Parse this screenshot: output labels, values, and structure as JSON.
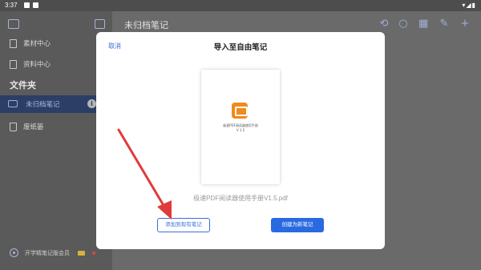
{
  "statusbar": {
    "time": "3:37"
  },
  "sidebar": {
    "items": [
      {
        "label": "素材中心"
      },
      {
        "label": "资料中心"
      }
    ],
    "folder_title": "文件夹",
    "folders": [
      {
        "label": "未归档笔记",
        "active": true
      },
      {
        "label": "废纸篓"
      }
    ],
    "bottom_label": "开学精笔记版会员"
  },
  "main": {
    "title": "未归档笔记",
    "toolbar_icons": [
      "sync-icon",
      "search-icon",
      "grid-icon",
      "edit-icon",
      "add-icon"
    ]
  },
  "dialog": {
    "cancel": "取消",
    "title": "导入至自由笔记",
    "thumbnail_caption_line1": "极速PDF阅读器使用手册",
    "thumbnail_caption_line2": "V 1.5",
    "filename": "极速PDF阅读器使用手册V1.5.pdf",
    "add_existing": "添加到现有笔记",
    "create_new": "创建为新笔记"
  },
  "colors": {
    "accent": "#2a6ae0",
    "annotation_arrow": "#e03b3b",
    "sidebar_active": "#2c3e66"
  }
}
